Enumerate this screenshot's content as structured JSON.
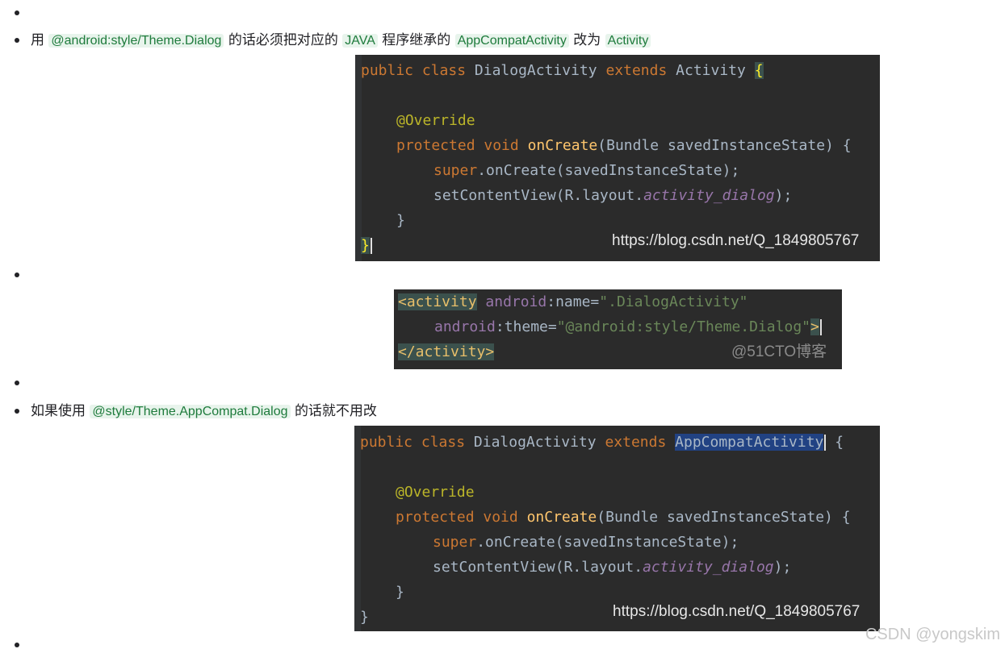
{
  "item1": {
    "pre": "用",
    "code1": "@android:style/Theme.Dialog",
    "mid1": "的话必须把对应的",
    "code2": "JAVA",
    "mid2": "程序继承的",
    "code3": "AppCompatActivity",
    "mid3": "改为",
    "code4": "Activity"
  },
  "shot1": {
    "l1_public": "public ",
    "l1_class": "class ",
    "l1_name": "DialogActivity ",
    "l1_extends": "extends ",
    "l1_parent": "Activity ",
    "l1_brace": "{",
    "l2": "@Override",
    "l3_protected": "protected ",
    "l3_void": "void ",
    "l3_fn": "onCreate",
    "l3_rest": "(Bundle savedInstanceState) {",
    "l4_super": "super",
    "l4_rest": ".onCreate(savedInstanceState);",
    "l5_pre": "setContentView(R.layout.",
    "l5_field": "activity_dialog",
    "l5_post": ");",
    "l6": "}",
    "l7": "}",
    "watermark": "https://blog.csdn.net/Q_1849805767"
  },
  "shot2": {
    "l1_tag": "<activity",
    "l1_attr": "android",
    "l1_colon": ":name=",
    "l1_val": "\".DialogActivity\"",
    "l2_attr": "android",
    "l2_colon": ":theme=",
    "l2_val": "\"@android:style/Theme.Dialog\"",
    "l2_end": ">",
    "l3_tag": "</activity>",
    "watermark": "@51CTO博客"
  },
  "item2": {
    "pre": "如果使用",
    "code1": "@style/Theme.AppCompat.Dialog",
    "post": "的话就不用改"
  },
  "shot3": {
    "l1_public": "public ",
    "l1_class": "class ",
    "l1_name": "DialogActivity ",
    "l1_extends": "extends ",
    "l1_parent": "AppCompatActivity",
    "l1_brace": " {",
    "l2": "@Override",
    "l3_protected": "protected ",
    "l3_void": "void ",
    "l3_fn": "onCreate",
    "l3_rest": "(Bundle savedInstanceState) {",
    "l4_super": "super",
    "l4_rest": ".onCreate(savedInstanceState);",
    "l5_pre": "setContentView(R.layout.",
    "l5_field": "activity_dialog",
    "l5_post": ");",
    "l6": "}",
    "l7": "}",
    "watermark": "https://blog.csdn.net/Q_1849805767"
  },
  "page_watermark": "CSDN @yongskim"
}
